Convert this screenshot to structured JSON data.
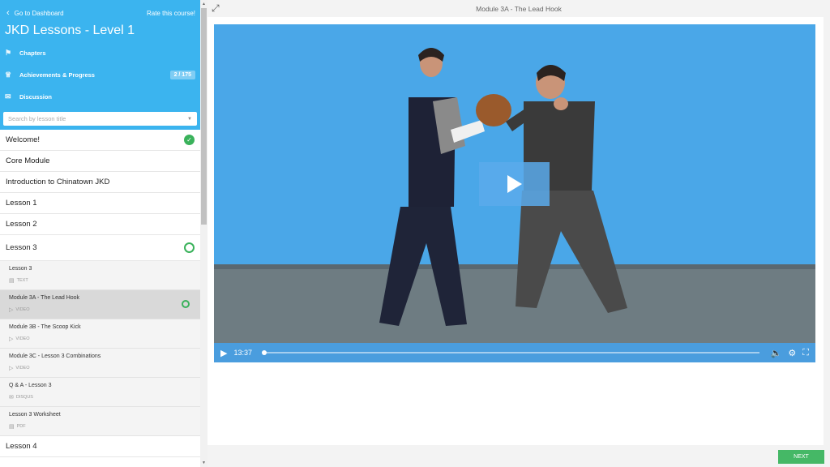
{
  "sidebar": {
    "back_label": "Go to Dashboard",
    "rate_label": "Rate this course!",
    "course_title": "JKD Lessons - Level 1",
    "nav": [
      {
        "label": "Chapters",
        "icon": "bookmark-icon"
      },
      {
        "label": "Achievements & Progress",
        "icon": "trophy-icon",
        "badge": "2 / 175"
      },
      {
        "label": "Discussion",
        "icon": "chat-icon"
      }
    ],
    "search_placeholder": "Search by lesson title",
    "chapters_top": [
      {
        "label": "Welcome!",
        "status": "complete"
      },
      {
        "label": "Core Module"
      },
      {
        "label": "Introduction to Chinatown JKD"
      },
      {
        "label": "Lesson 1"
      },
      {
        "label": "Lesson 2"
      },
      {
        "label": "Lesson 3",
        "status": "in-progress"
      }
    ],
    "lessons": [
      {
        "title": "Lesson 3",
        "type": "TEXT",
        "icon": "document-icon"
      },
      {
        "title": "Module 3A - The Lead Hook",
        "type": "VIDEO",
        "icon": "video-icon",
        "active": true
      },
      {
        "title": "Module 3B - The Scoop Kick",
        "type": "VIDEO",
        "icon": "video-icon"
      },
      {
        "title": "Module 3C - Lesson 3 Combinations",
        "type": "VIDEO",
        "icon": "video-icon"
      },
      {
        "title": "Q & A - Lesson 3",
        "type": "DISQUS",
        "icon": "chat-icon"
      },
      {
        "title": "Lesson 3 Worksheet",
        "type": "PDF",
        "icon": "pdf-icon"
      }
    ],
    "chapters_bottom": [
      {
        "label": "Lesson 4"
      }
    ]
  },
  "main": {
    "title": "Module 3A - The Lead Hook",
    "video": {
      "time": "13:37",
      "progress": 0
    },
    "next_label": "NEXT"
  },
  "colors": {
    "header": "#3bb4ef",
    "accent_green": "#45b866",
    "video_bg": "#4ca8e8"
  }
}
